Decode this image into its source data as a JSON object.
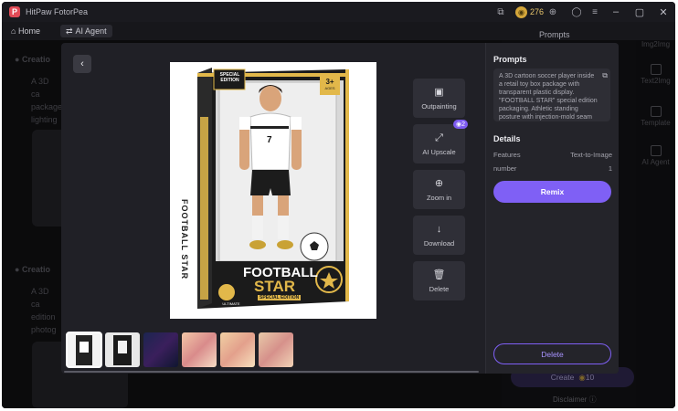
{
  "app": {
    "title": "HitPaw FotorPea",
    "credits": "276"
  },
  "nav": {
    "home": "Home",
    "agent_tab": "AI Agent",
    "prompts_heading": "Prompts"
  },
  "background": {
    "item1_title": "Creatio",
    "item1_text": "A 3D ca package lighting",
    "item2_title": "Creatio",
    "item2_text": "A 3D ca edition photog",
    "rail": [
      "Img2Img",
      "Text2Img",
      "Template",
      "AI Agent"
    ],
    "create_label": "Create",
    "create_cost": "10",
    "disclaimer": "Disclaimer"
  },
  "modal": {
    "tools": [
      {
        "label": "Outpainting",
        "icon": "outpainting-icon"
      },
      {
        "label": "AI Upscale",
        "icon": "upscale-icon",
        "badge": "2"
      },
      {
        "label": "Zoom in",
        "icon": "zoom-in-icon"
      },
      {
        "label": "Download",
        "icon": "download-icon"
      },
      {
        "label": "Delete",
        "icon": "trash-icon"
      }
    ],
    "product": {
      "special_edition": "SPECIAL EDITION",
      "age": "3+",
      "age_sub": "AGES",
      "side_text": "FOOTBALL STAR",
      "title_line1": "FOOTBALL",
      "title_line2": "STAR",
      "subtitle": "SPECIAL EDITION",
      "ultimate": "ULTIMATE ACTION FIGURE",
      "jersey_number": "7"
    },
    "side_panel": {
      "prompts_heading": "Prompts",
      "prompt_text": "A 3D cartoon soccer player inside a retail toy box package with transparent plastic display. \"FOOTBALL STAR\" special edition packaging. Athletic standing posture with injection-mold seam lines",
      "details_heading": "Details",
      "details": [
        {
          "label": "Features",
          "value": "Text-to-Image"
        },
        {
          "label": "number",
          "value": "1"
        }
      ],
      "remix": "Remix",
      "delete": "Delete"
    }
  },
  "colors": {
    "accent": "#7f60f5",
    "gold": "#e2b84a",
    "background": "#17171b"
  }
}
